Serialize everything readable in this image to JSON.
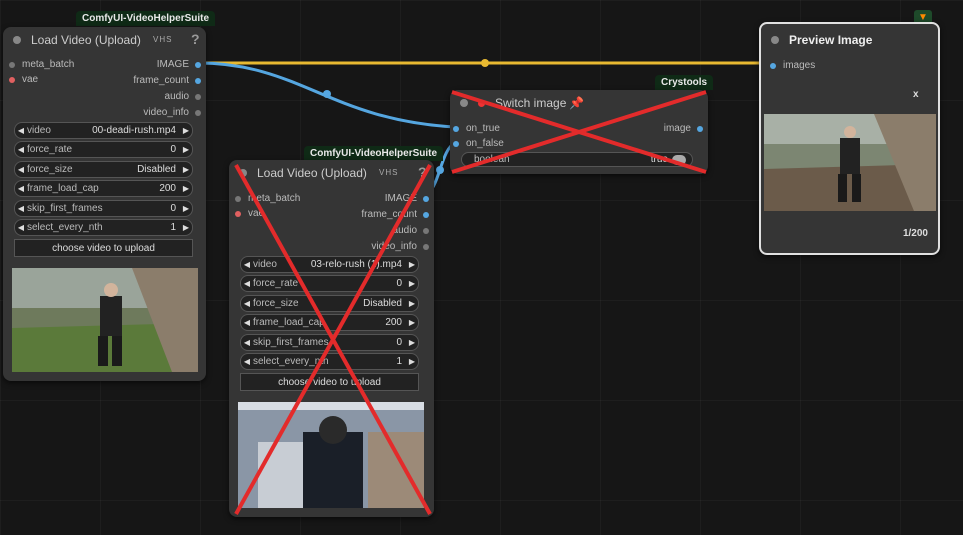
{
  "colors": {
    "image_link": "#e8b931",
    "latent_link": "#55a6e0",
    "canvas": "#161616",
    "node": "#353535",
    "cross": "#e32b2b"
  },
  "node1": {
    "badge": "ComfyUI-VideoHelperSuite",
    "title": "Load Video (Upload)",
    "inputs": [
      "meta_batch",
      "vae"
    ],
    "outputs": [
      "IMAGE",
      "frame_count",
      "audio",
      "video_info"
    ],
    "widgets": [
      {
        "label": "video",
        "value": "00-deadi-rush.mp4"
      },
      {
        "label": "force_rate",
        "value": "0"
      },
      {
        "label": "force_size",
        "value": "Disabled"
      },
      {
        "label": "frame_load_cap",
        "value": "200"
      },
      {
        "label": "skip_first_frames",
        "value": "0"
      },
      {
        "label": "select_every_nth",
        "value": "1"
      }
    ],
    "button": "choose video to upload"
  },
  "node2": {
    "badge": "ComfyUI-VideoHelperSuite",
    "title": "Load Video (Upload)",
    "inputs": [
      "meta_batch",
      "vae"
    ],
    "outputs": [
      "IMAGE",
      "frame_count",
      "audio",
      "video_info"
    ],
    "widgets": [
      {
        "label": "video",
        "value": "03-relo-rush (1).mp4"
      },
      {
        "label": "force_rate",
        "value": "0"
      },
      {
        "label": "force_size",
        "value": "Disabled"
      },
      {
        "label": "frame_load_cap",
        "value": "200"
      },
      {
        "label": "skip_first_frames",
        "value": "0"
      },
      {
        "label": "select_every_nth",
        "value": "1"
      }
    ],
    "button": "choose video to upload"
  },
  "switch": {
    "badge": "Crystools",
    "title": "Switch image",
    "inputs": [
      "on_true",
      "on_false"
    ],
    "output": "image",
    "toggle_label": "boolean",
    "toggle_value": "true"
  },
  "preview": {
    "title": "Preview Image",
    "input": "images",
    "close": "x",
    "counter": "1/200"
  },
  "icons": {
    "help": "?",
    "vhs": "VHS",
    "pin": "pin-icon",
    "fox": "fox-icon",
    "arrow_left": "◀",
    "arrow_right": "▶"
  }
}
